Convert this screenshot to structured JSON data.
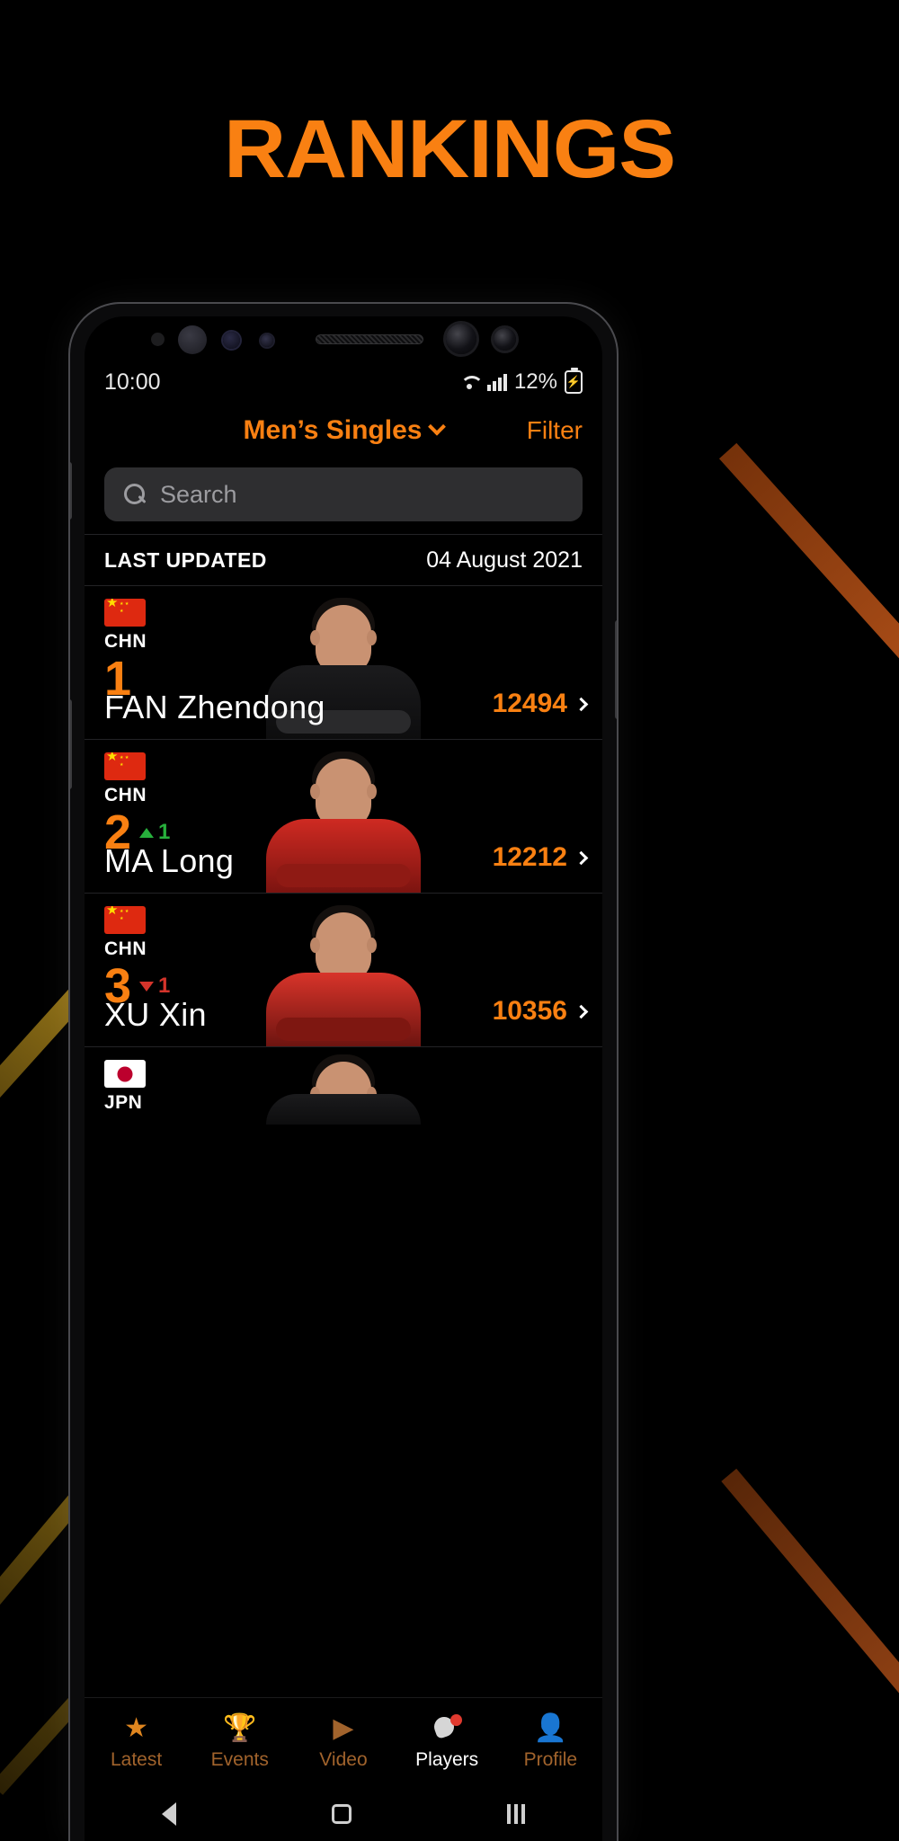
{
  "poster": {
    "title": "RANKINGS",
    "accent_color": "#f98012"
  },
  "status_bar": {
    "time": "10:00",
    "battery_percent": "12%",
    "wifi_icon": "wifi-icon",
    "signal_icon": "signal-bars-icon",
    "battery_icon": "battery-charging-icon"
  },
  "header": {
    "category": "Men’s Singles",
    "category_chevron": "chevron-down-icon",
    "filter_label": "Filter"
  },
  "search": {
    "placeholder": "Search",
    "icon": "search-icon",
    "value": ""
  },
  "last_updated": {
    "label": "LAST UPDATED",
    "date": "04 August 2021"
  },
  "rankings": [
    {
      "noc": "CHN",
      "flag": "cn",
      "rank": "1",
      "move_dir": "none",
      "move_value": "",
      "name": "FAN Zhendong",
      "points": "12494",
      "chevron": "chevron-right-icon",
      "kit": "black"
    },
    {
      "noc": "CHN",
      "flag": "cn",
      "rank": "2",
      "move_dir": "up",
      "move_value": "1",
      "name": "MA Long",
      "points": "12212",
      "chevron": "chevron-right-icon",
      "kit": "red"
    },
    {
      "noc": "CHN",
      "flag": "cn",
      "rank": "3",
      "move_dir": "down",
      "move_value": "1",
      "name": "XU Xin",
      "points": "10356",
      "chevron": "chevron-right-icon",
      "kit": "red2"
    },
    {
      "noc": "JPN",
      "flag": "jp",
      "rank": "",
      "move_dir": "none",
      "move_value": "",
      "name": "",
      "points": "",
      "chevron": "chevron-right-icon",
      "kit": "black"
    }
  ],
  "bottom_nav": [
    {
      "label": "Latest",
      "icon": "star-icon",
      "active": false
    },
    {
      "label": "Events",
      "icon": "trophy-icon",
      "active": false
    },
    {
      "label": "Video",
      "icon": "play-icon",
      "active": false
    },
    {
      "label": "Players",
      "icon": "paddle-ball-icon",
      "active": true
    },
    {
      "label": "Profile",
      "icon": "person-icon",
      "active": false
    }
  ],
  "android_nav": {
    "back": "back-triangle-icon",
    "home": "home-square-icon",
    "recents": "recents-bars-icon"
  }
}
